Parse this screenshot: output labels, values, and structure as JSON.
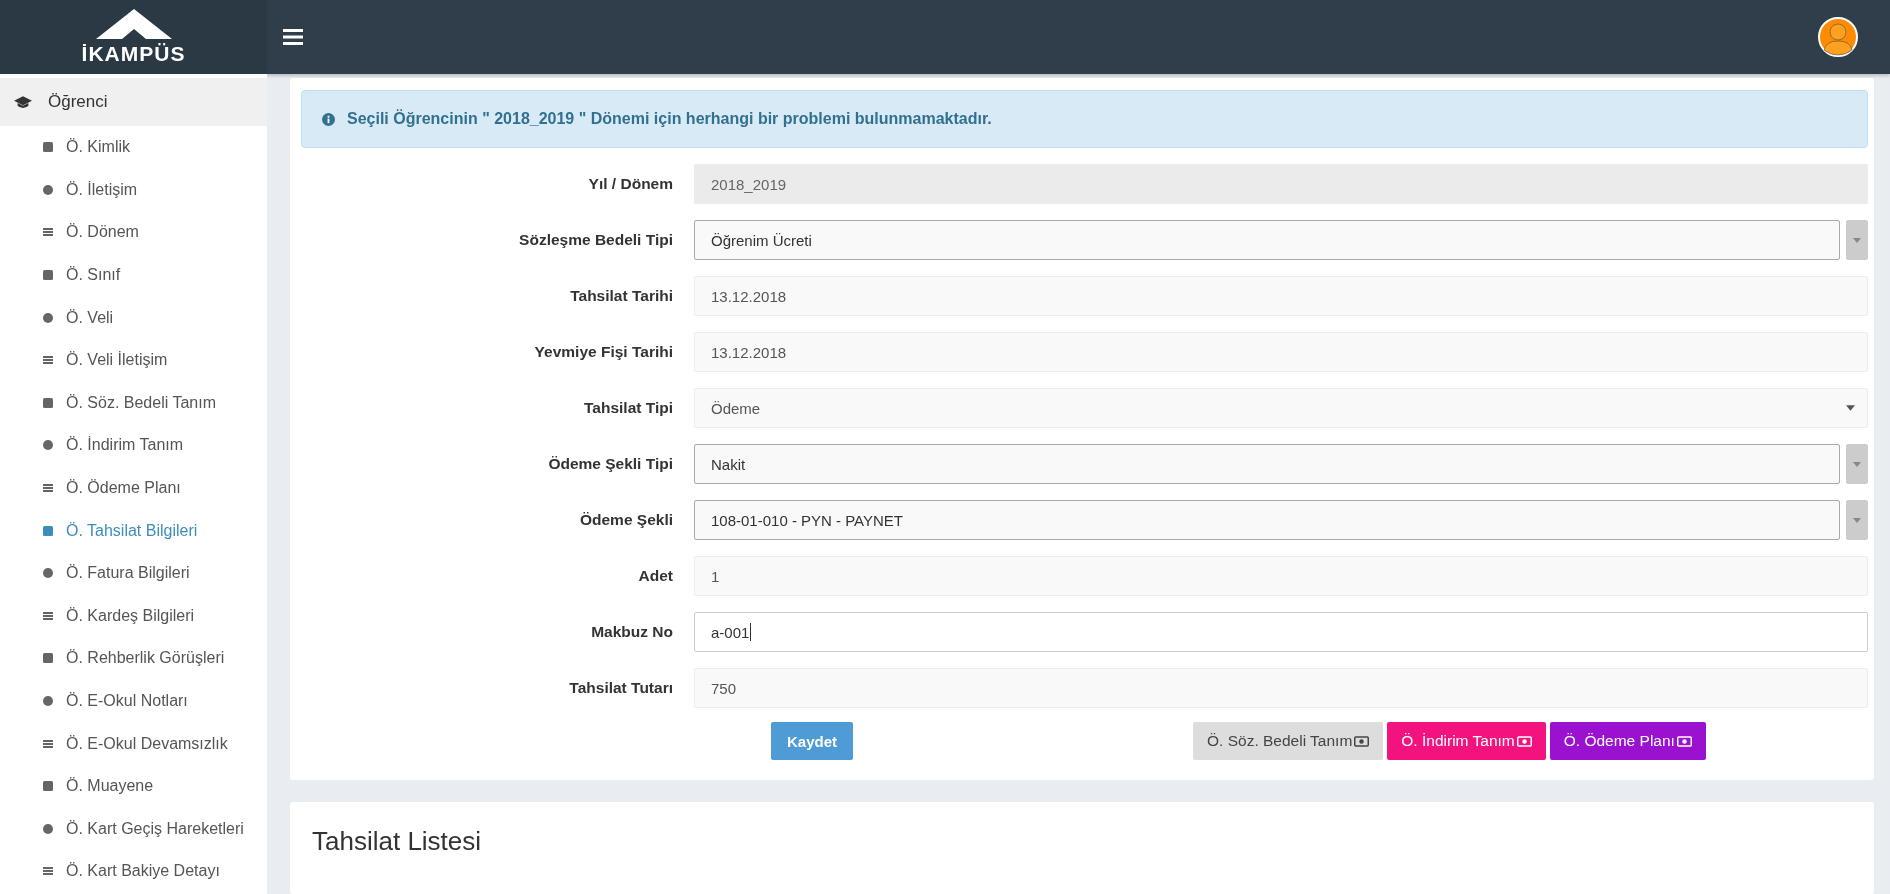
{
  "topbar": {
    "logo_text": "İKAMPÜS"
  },
  "sidebar": {
    "group": {
      "label": "Öğrenci",
      "expanded": true,
      "items": [
        {
          "label": "Ö. Kimlik",
          "selected": false
        },
        {
          "label": "Ö. İletişim",
          "selected": false
        },
        {
          "label": "Ö. Dönem",
          "selected": false
        },
        {
          "label": "Ö. Sınıf",
          "selected": false
        },
        {
          "label": "Ö. Veli",
          "selected": false
        },
        {
          "label": "Ö. Veli İletişim",
          "selected": false
        },
        {
          "label": "Ö. Söz. Bedeli Tanım",
          "selected": false
        },
        {
          "label": "Ö. İndirim Tanım",
          "selected": false
        },
        {
          "label": "Ö. Ödeme Planı",
          "selected": false
        },
        {
          "label": "Ö. Tahsilat Bilgileri",
          "selected": true
        },
        {
          "label": "Ö. Fatura Bilgileri",
          "selected": false
        },
        {
          "label": "Ö. Kardeş Bilgileri",
          "selected": false
        },
        {
          "label": "Ö. Rehberlik Görüşleri",
          "selected": false
        },
        {
          "label": "Ö. E-Okul Notları",
          "selected": false
        },
        {
          "label": "Ö. E-Okul Devamsızlık",
          "selected": false
        },
        {
          "label": "Ö. Muayene",
          "selected": false
        },
        {
          "label": "Ö. Kart Geçiş Hareketleri",
          "selected": false
        },
        {
          "label": "Ö. Kart Bakiye Detayı",
          "selected": false
        }
      ]
    }
  },
  "alert": {
    "message": "Seçili Öğrencinin \" 2018_2019 \" Dönemi için herhangi bir problemi bulunmamaktadır."
  },
  "form": {
    "fields": [
      {
        "label": "Yıl / Dönem",
        "kind": "disabled",
        "value": "2018_2019"
      },
      {
        "label": "Sözleşme Bedeli Tipi",
        "kind": "combo",
        "value": "Öğrenim Ücreti"
      },
      {
        "label": "Tahsilat Tarihi",
        "kind": "readonly",
        "value": "13.12.2018"
      },
      {
        "label": "Yevmiye Fişi Tarihi",
        "kind": "readonly",
        "value": "13.12.2018"
      },
      {
        "label": "Tahsilat Tipi",
        "kind": "select",
        "value": "Ödeme"
      },
      {
        "label": "Ödeme Şekli Tipi",
        "kind": "combo",
        "value": "Nakit"
      },
      {
        "label": "Ödeme Şekli",
        "kind": "combo",
        "value": "108-01-010 - PYN - PAYNET"
      },
      {
        "label": "Adet",
        "kind": "readonly",
        "value": "1"
      },
      {
        "label": "Makbuz No",
        "kind": "input",
        "value": "a-001"
      },
      {
        "label": "Tahsilat Tutarı",
        "kind": "readonly",
        "value": "750"
      }
    ],
    "save_button": "Kaydet",
    "link_buttons": [
      {
        "label": "Ö. Söz. Bedeli Tanım",
        "color": "#dddddd"
      },
      {
        "label": "Ö. İndirim Tanım",
        "color": "#f2137f"
      },
      {
        "label": "Ö. Ödeme Planı",
        "color": "#9a12cf"
      }
    ]
  },
  "list_card": {
    "title": "Tahsilat Listesi"
  }
}
